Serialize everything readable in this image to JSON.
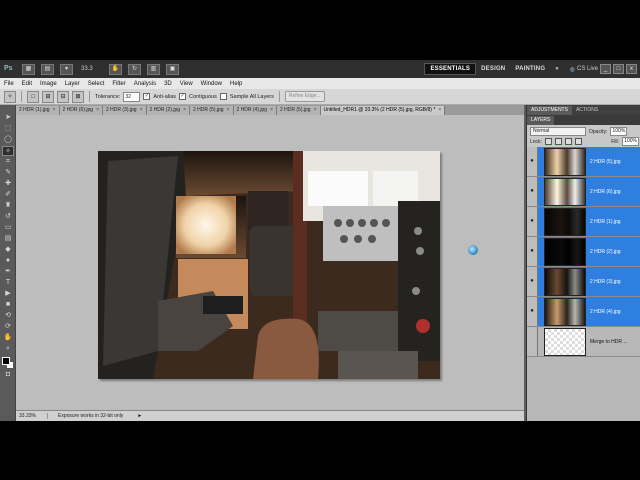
{
  "app": {
    "logo": "Ps",
    "zoom_level": "33.3",
    "workspaces": [
      "ESSENTIALS",
      "DESIGN",
      "PAINTING"
    ],
    "more_label": "»",
    "cs_live": "CS Live",
    "win_min": "_",
    "win_max": "□",
    "win_close": "x"
  },
  "menu": [
    "File",
    "Edit",
    "Image",
    "Layer",
    "Select",
    "Filter",
    "Analysis",
    "3D",
    "View",
    "Window",
    "Help"
  ],
  "options": {
    "tolerance_label": "Tolerance:",
    "tolerance_value": "32",
    "anti_alias_label": "Anti-alias",
    "contiguous_label": "Contiguous",
    "sample_all_label": "Sample All Layers",
    "refine_edge_label": "Refine Edge..."
  },
  "tabs": [
    {
      "label": "2 HDR (1).jpg"
    },
    {
      "label": "2 HDR (6).jpg"
    },
    {
      "label": "2 HDR (3).jpg"
    },
    {
      "label": "2 HDR (2).jpg"
    },
    {
      "label": "2 HDR (5).jpg"
    },
    {
      "label": "2 HDR (4).jpg"
    },
    {
      "label": "2 HDR (5).jpg"
    },
    {
      "label": "Untitled_HDR1 @ 33.3% (2 HDR (5).jpg, RGB/8) *"
    }
  ],
  "tab_close": "×",
  "status": {
    "zoom": "33.33%",
    "info": "Exposure works in 32-bit only",
    "arrow": "►"
  },
  "panels": {
    "adjustments_tab": "ADJUSTMENTS",
    "actions_tab": "ACTIONS",
    "layers_tab": "LAYERS",
    "blend_mode": "Normal",
    "opacity_label": "Opacity:",
    "opacity_value": "100%",
    "lock_label": "Lock:",
    "fill_label": "Fill:",
    "fill_value": "100%"
  },
  "layers": [
    {
      "name": "2 HDR (5).jpg"
    },
    {
      "name": "2 HDR (6).jpg"
    },
    {
      "name": "2 HDR (1).jpg"
    },
    {
      "name": "2 HDR (2).jpg"
    },
    {
      "name": "2 HDR (3).jpg"
    },
    {
      "name": "2 HDR (4).jpg"
    },
    {
      "name": "Merge to HDR ..."
    }
  ],
  "eye_icon": "●",
  "colors": {
    "selection": "#2f7fe0",
    "canvas_bg": "#bdbdbd",
    "appbar": "#2f2f2f"
  }
}
